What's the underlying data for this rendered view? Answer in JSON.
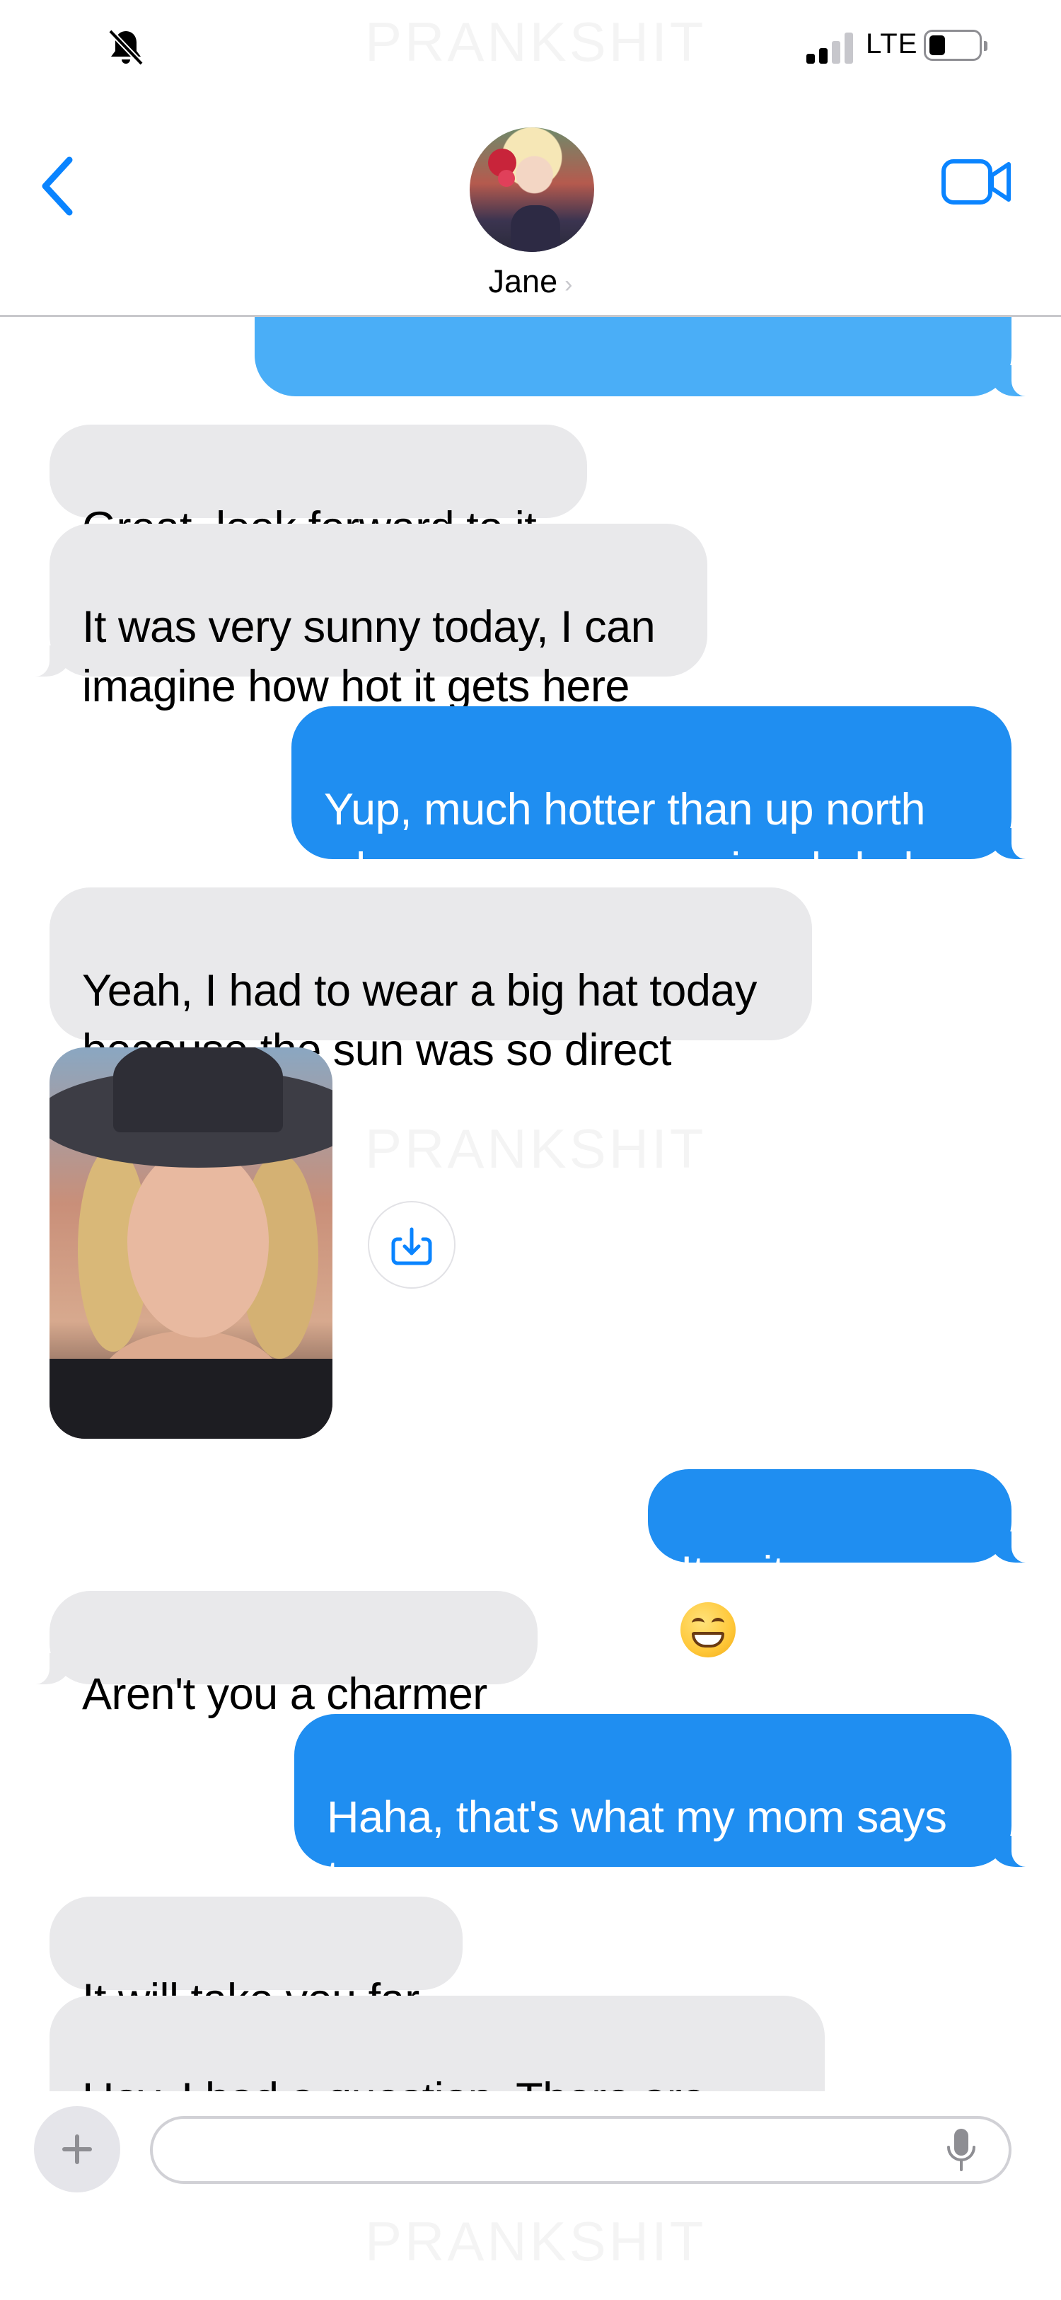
{
  "status_bar": {
    "network": "LTE",
    "icons": [
      "mute-bell-icon",
      "signal-icon",
      "battery-icon"
    ]
  },
  "watermark": "PRANKSHIT",
  "header": {
    "contact_name": "Jane",
    "icons": [
      "back-chevron-icon",
      "video-call-icon",
      "chevron-right-icon"
    ]
  },
  "messages": [
    {
      "side": "out",
      "text": ""
    },
    {
      "side": "in",
      "text": "Great, look forward to it"
    },
    {
      "side": "in",
      "text": "It was very sunny today, I can\nimagine how hot it gets here"
    },
    {
      "side": "out",
      "text": "Yup, much hotter than up north\nwhere you were previously haha"
    },
    {
      "side": "in",
      "text": "Yeah, I had to wear a big hat today\nbecause the sun was so direct"
    },
    {
      "side": "out",
      "text": "It suits you "
    },
    {
      "side": "in",
      "text": "Aren't you a charmer"
    },
    {
      "side": "out",
      "text": "Haha, that's what my mom says\ntoo"
    },
    {
      "side": "in",
      "text": "It will take you far"
    },
    {
      "side": "in",
      "text": "Hey, I had a question. There are"
    }
  ],
  "input": {
    "placeholder": ""
  },
  "colors": {
    "outgoing_bubble": "#1f8ef1",
    "incoming_bubble": "#e9e9eb",
    "accent": "#0a84ff"
  }
}
